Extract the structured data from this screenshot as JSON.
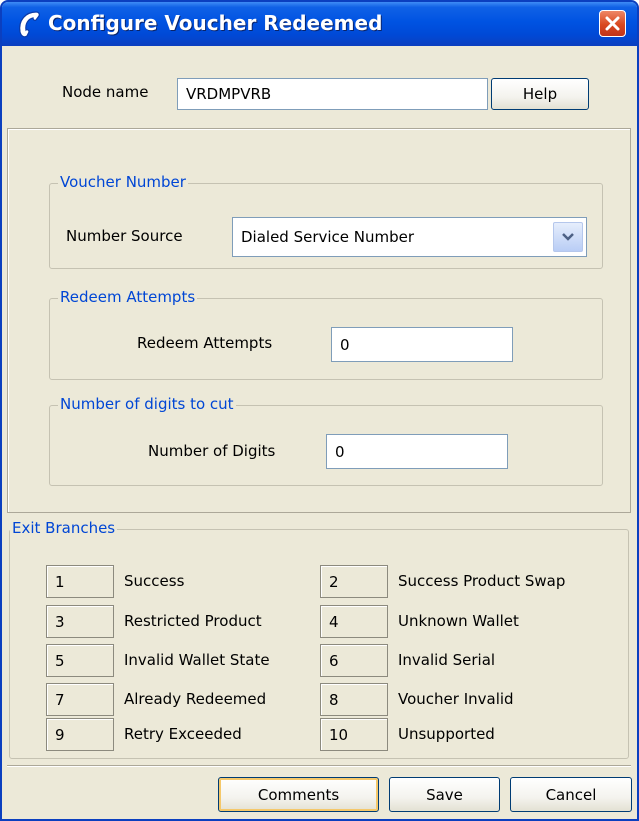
{
  "window": {
    "title": "Configure Voucher Redeemed"
  },
  "node": {
    "label": "Node name",
    "value": "VRDMPVRB",
    "help_label": "Help"
  },
  "voucher_number": {
    "title": "Voucher Number",
    "source_label": "Number Source",
    "source_value": "Dialed Service Number"
  },
  "redeem_attempts": {
    "title": "Redeem Attempts",
    "label": "Redeem Attempts",
    "value": "0"
  },
  "digits_to_cut": {
    "title": "Number of digits to cut",
    "label": "Number of Digits",
    "value": "0"
  },
  "exit_branches": {
    "title": "Exit Branches",
    "items": [
      {
        "num": "1",
        "label": "Success"
      },
      {
        "num": "2",
        "label": "Success Product Swap"
      },
      {
        "num": "3",
        "label": "Restricted Product"
      },
      {
        "num": "4",
        "label": "Unknown Wallet"
      },
      {
        "num": "5",
        "label": "Invalid Wallet State"
      },
      {
        "num": "6",
        "label": "Invalid Serial"
      },
      {
        "num": "7",
        "label": "Already Redeemed"
      },
      {
        "num": "8",
        "label": "Voucher Invalid"
      },
      {
        "num": "9",
        "label": "Retry Exceeded"
      },
      {
        "num": "10",
        "label": "Unsupported"
      }
    ]
  },
  "buttons": {
    "comments": "Comments",
    "save": "Save",
    "cancel": "Cancel"
  },
  "icons": {
    "title": "phone-handset-icon",
    "close": "close-icon",
    "dropdown": "chevron-down-icon"
  },
  "colors": {
    "titlebar": "#0053e2",
    "group_title": "#0046d5",
    "dialog_bg": "#ece9d8",
    "close_button": "#d9481f"
  }
}
